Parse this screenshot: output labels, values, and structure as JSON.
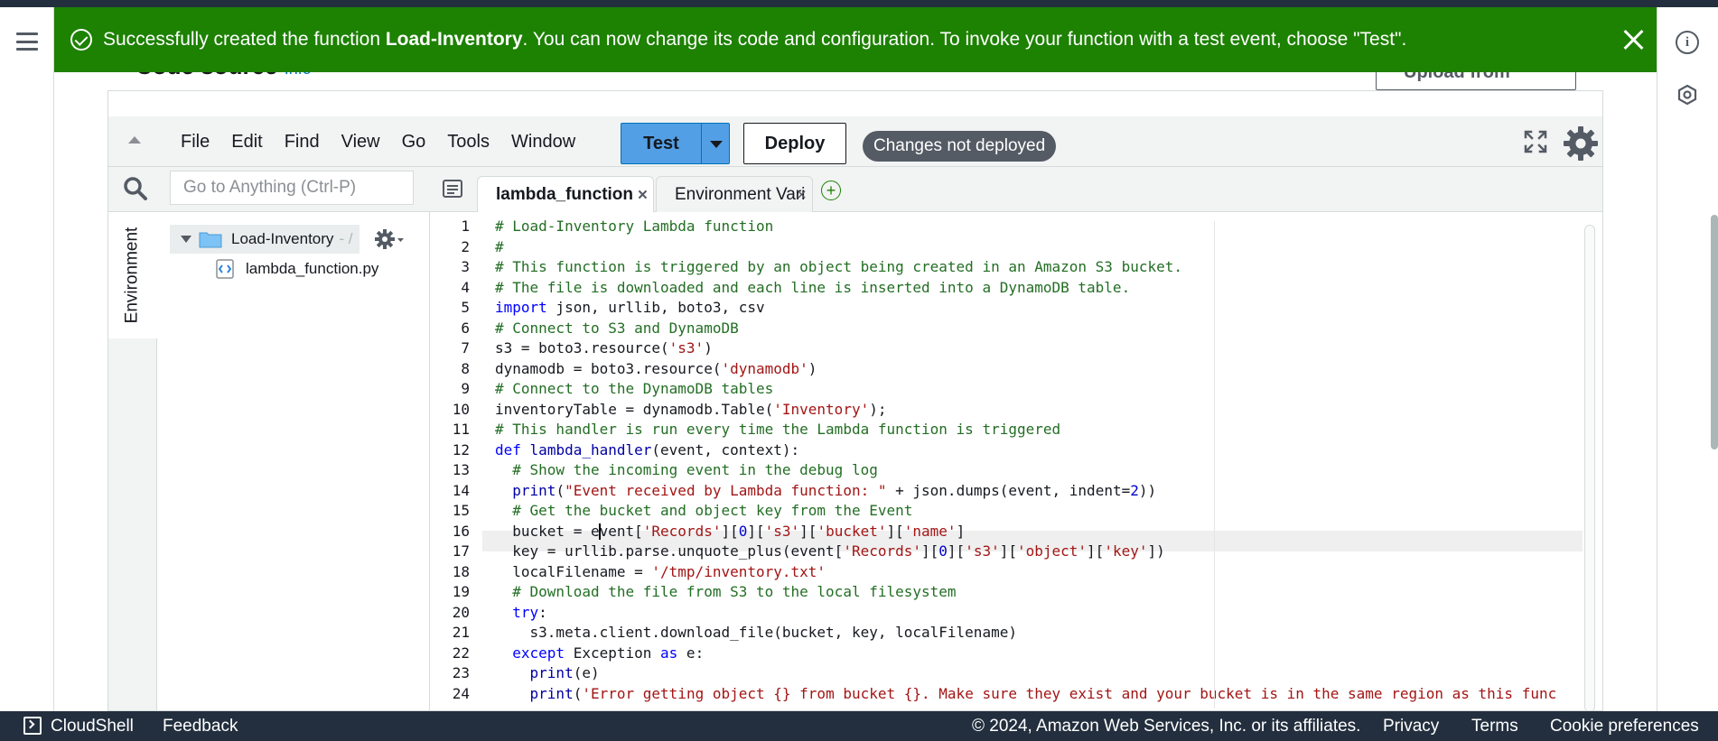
{
  "flash": {
    "prefix": "Successfully created the function ",
    "function_name": "Load-Inventory",
    "suffix": ". You can now change its code and configuration. To invoke your function with a test event, choose \"Test\"."
  },
  "header_partial": {
    "title": "Code source",
    "info": "Info",
    "upload_label": "Upload from"
  },
  "toolbar": {
    "menu": [
      "File",
      "Edit",
      "Find",
      "View",
      "Go",
      "Tools",
      "Window"
    ],
    "test_label": "Test",
    "deploy_label": "Deploy",
    "status": "Changes not deployed"
  },
  "search": {
    "placeholder": "Go to Anything (Ctrl-P)"
  },
  "tabs": [
    {
      "label": "lambda_function",
      "active": true
    },
    {
      "label": "Environment Vari",
      "active": false
    }
  ],
  "sidebar": {
    "env_tab": "Environment",
    "root_label": "Load-Inventory",
    "root_suffix": "- /",
    "file_label": "lambda_function.py"
  },
  "editor": {
    "highlighted_line": 16,
    "lines": [
      "# Load-Inventory Lambda function",
      "#",
      "# This function is triggered by an object being created in an Amazon S3 bucket.",
      "# The file is downloaded and each line is inserted into a DynamoDB table.",
      "import json, urllib, boto3, csv",
      "# Connect to S3 and DynamoDB",
      "s3 = boto3.resource('s3')",
      "dynamodb = boto3.resource('dynamodb')",
      "# Connect to the DynamoDB tables",
      "inventoryTable = dynamodb.Table('Inventory');",
      "# This handler is run every time the Lambda function is triggered",
      "def lambda_handler(event, context):",
      "  # Show the incoming event in the debug log",
      "  print(\"Event received by Lambda function: \" + json.dumps(event, indent=2))",
      "  # Get the bucket and object key from the Event",
      "  bucket = event['Records'][0]['s3']['bucket']['name']",
      "  key = urllib.parse.unquote_plus(event['Records'][0]['s3']['object']['key'])",
      "  localFilename = '/tmp/inventory.txt'",
      "  # Download the file from S3 to the local filesystem",
      "  try:",
      "    s3.meta.client.download_file(bucket, key, localFilename)",
      "  except Exception as e:",
      "    print(e)",
      "    print('Error getting object {} from bucket {}. Make sure they exist and your bucket is in the same region as this func"
    ]
  },
  "footer": {
    "cloudshell": "CloudShell",
    "feedback": "Feedback",
    "copyright": "© 2024, Amazon Web Services, Inc. or its affiliates.",
    "privacy": "Privacy",
    "terms": "Terms",
    "cookies": "Cookie preferences"
  },
  "colors": {
    "flash_bg": "#1d8102",
    "test_btn": "#539fe5",
    "status_pill": "#545b64",
    "footer_bg": "#232f3e"
  }
}
